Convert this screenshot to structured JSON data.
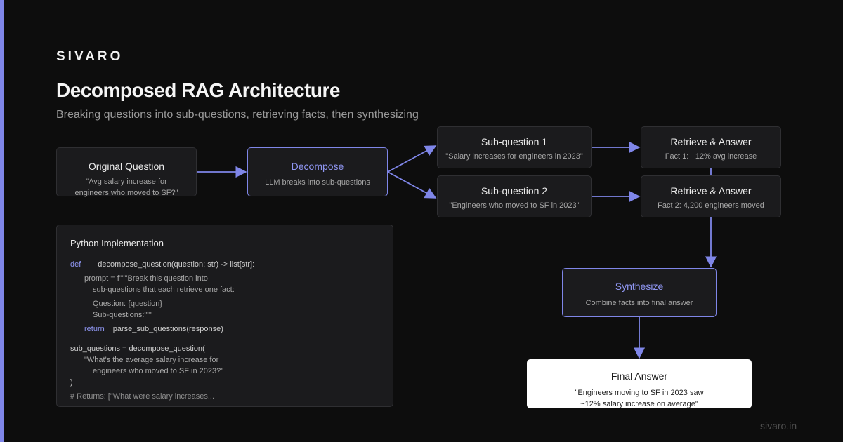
{
  "brand": "SIVARO",
  "title": "Decomposed RAG Architecture",
  "subtitle": "Breaking questions into sub-questions, retrieving facts, then synthesizing",
  "footer": "sivaro.in",
  "accent_color": "#7f86e8",
  "nodes": {
    "original": {
      "title": "Original Question",
      "sub_line1": "\"Avg salary increase for",
      "sub_line2": "engineers who moved to SF?\""
    },
    "decompose": {
      "title": "Decompose",
      "sub": "LLM breaks into sub-questions"
    },
    "sub1": {
      "title": "Sub-question 1",
      "sub": "\"Salary increases for engineers in 2023\""
    },
    "sub2": {
      "title": "Sub-question 2",
      "sub": "\"Engineers who moved to SF in 2023\""
    },
    "retrieve1": {
      "title": "Retrieve & Answer",
      "sub": "Fact 1: +12% avg increase"
    },
    "retrieve2": {
      "title": "Retrieve & Answer",
      "sub": "Fact 2: 4,200 engineers moved"
    },
    "synthesize": {
      "title": "Synthesize",
      "sub": "Combine facts into final answer"
    },
    "final": {
      "title": "Final Answer",
      "sub_line1": "\"Engineers moving to SF in 2023 saw",
      "sub_line2": "~12% salary increase on average\""
    }
  },
  "code": {
    "title": "Python Implementation",
    "def_kw": "def",
    "def_sig": "decompose_question(question: str) -> list[str]:",
    "prompt_line1": "prompt = f\"\"\"Break this question into",
    "prompt_line2": "sub-questions that each retrieve one fact:",
    "question_line": "Question: {question}",
    "subq_line": "Sub-questions:\"\"\"",
    "return_kw": "return",
    "return_expr": "parse_sub_questions(response)",
    "call_line": "sub_questions = decompose_question(",
    "arg_line1": "\"What's the average salary increase for",
    "arg_line2": "engineers who moved to SF in 2023?\"",
    "close_paren": ")",
    "comment": "# Returns: [\"What were salary increases..."
  }
}
